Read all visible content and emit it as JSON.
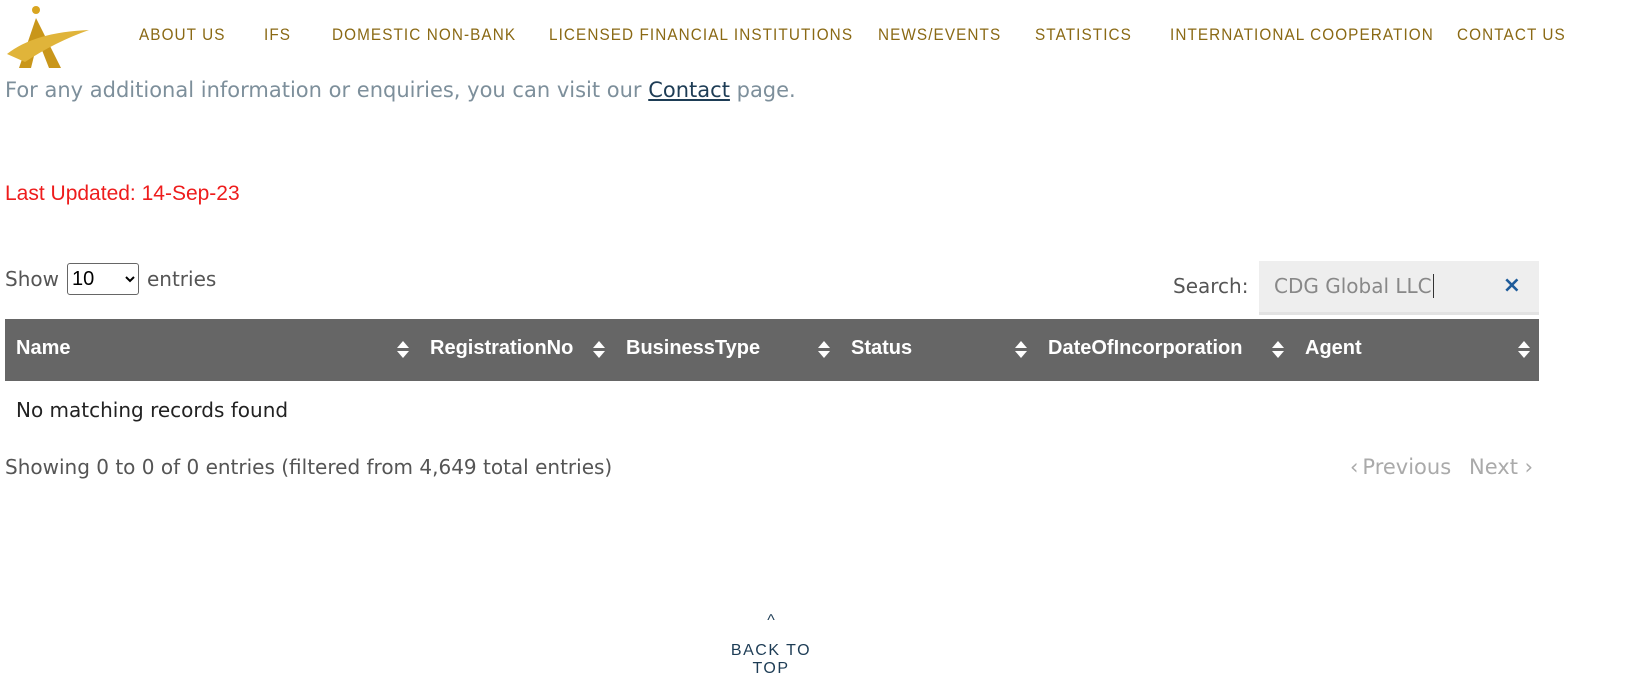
{
  "nav": [
    "ABOUT US",
    "IFS",
    "DOMESTIC NON-BANK",
    "LICENSED FINANCIAL INSTITUTIONS",
    "NEWS/EVENTS",
    "STATISTICS",
    "INTERNATIONAL COOPERATION",
    "CONTACT US"
  ],
  "info": {
    "prefix": "For any additional information or enquiries, you can visit our ",
    "link": "Contact",
    "suffix": " page."
  },
  "last_updated": "Last Updated:  14-Sep-23",
  "length": {
    "show": "Show",
    "value": "10",
    "entries": "entries"
  },
  "search": {
    "label": "Search:",
    "value": "CDG Global LLC",
    "clear_icon": "×"
  },
  "table": {
    "columns": [
      "Name",
      "RegistrationNo",
      "BusinessType",
      "Status",
      "DateOfIncorporation",
      "Agent"
    ],
    "empty": "No matching records found"
  },
  "info_text": "Showing 0 to 0 of 0 entries (filtered from 4,649 total entries)",
  "pagination": {
    "previous": "Previous",
    "next": "Next"
  },
  "back_to_top": {
    "arrow": "^",
    "label": "BACK TO TOP"
  },
  "colors": {
    "nav": "#8a6914",
    "header": "#666666",
    "updated": "#ee1c1c"
  }
}
